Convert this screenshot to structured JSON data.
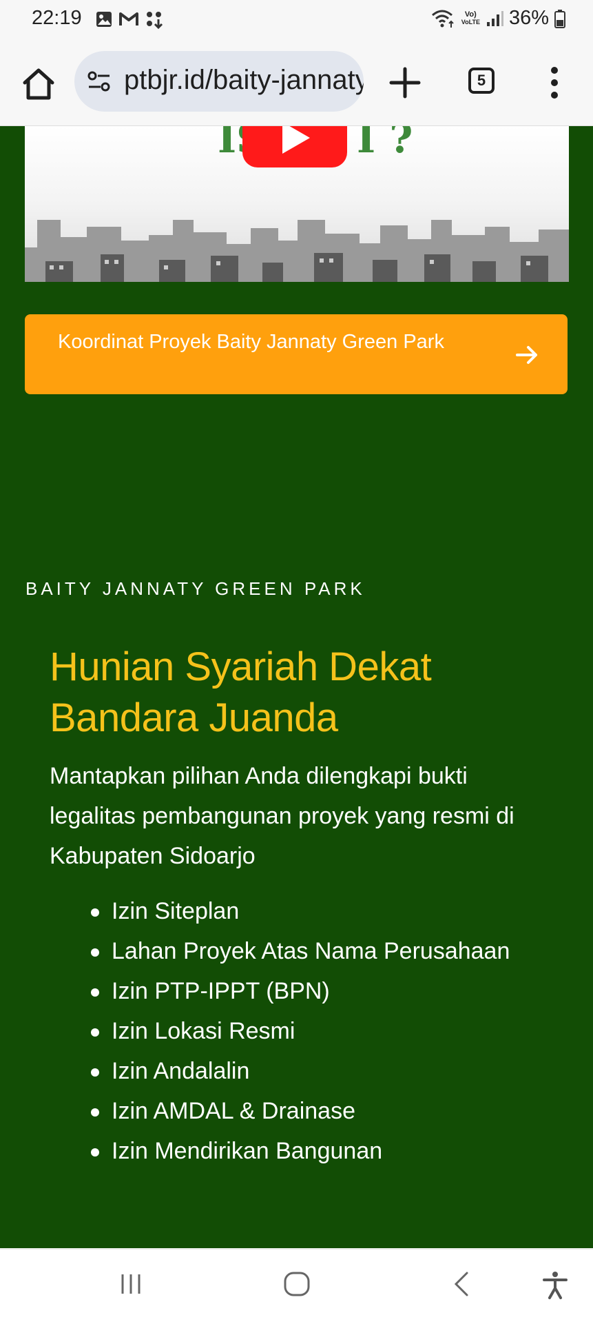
{
  "status_bar": {
    "time": "22:19",
    "battery": "36%",
    "network": "VoLTE"
  },
  "browser": {
    "url": "ptbjr.id/baity-jannaty",
    "tab_count": "5",
    "icons": [
      "home-icon",
      "site-settings-icon",
      "plus-icon",
      "tab-switcher-icon",
      "more-vert-icon"
    ]
  },
  "video": {
    "caption_left": "IS",
    "caption_right": "I ?"
  },
  "cta": {
    "label": "Koordinat Proyek Baity Jannaty Green Park",
    "color": "#ffa00d"
  },
  "section": {
    "eyebrow": "BAITY JANNATY GREEN PARK",
    "heading": "Hunian Syariah Dekat Bandara Juanda",
    "intro": "Mantapkan pilihan Anda dilengkapi bukti legalitas pembangunan proyek yang resmi di Kabupaten Sidoarjo",
    "permits": [
      "Izin Siteplan",
      "Lahan Proyek Atas Nama Perusahaan",
      "Izin PTP-IPPT (BPN)",
      "Izin Lokasi Resmi",
      "Izin Andalalin",
      "Izin AMDAL & Drainase",
      "Izin Mendirikan Bangunan"
    ]
  },
  "colors": {
    "page_background": "#124d05",
    "heading": "#f5c21b",
    "cta": "#ffa00d"
  }
}
